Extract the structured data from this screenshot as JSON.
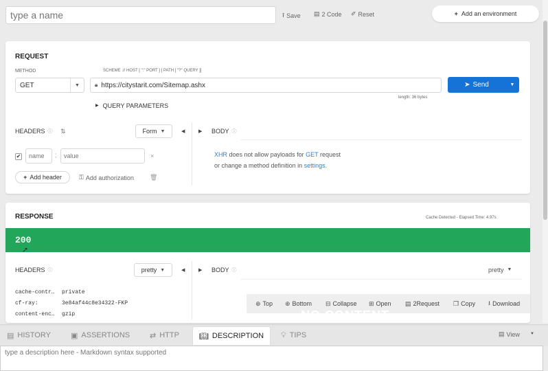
{
  "topbar": {
    "name_placeholder": "type a name",
    "save_label": "Save",
    "code_label": "2 Code",
    "reset_label": "Reset",
    "add_env_label": "Add an environment"
  },
  "request": {
    "title": "REQUEST",
    "method_label": "METHOD",
    "method_value": "GET",
    "scheme_label": "SCHEME :// HOST [ \":\" PORT ] [ PATH [ \"?\" QUERY ]]",
    "url_value": "https://citystarit.com/Sitemap.ashx",
    "length_text": "length: 36 bytes",
    "send_label": "Send",
    "query_params_label": "QUERY PARAMETERS",
    "headers_label": "HEADERS",
    "form_label": "Form",
    "body_label": "BODY",
    "header_name_placeholder": "name",
    "header_value_placeholder": "value",
    "add_header_label": "Add header",
    "add_authorization_label": "Add authorization",
    "body_message_part1": "does not allow payloads for",
    "body_message_xhr": "XHR",
    "body_message_get": "GET",
    "body_message_request": "request",
    "body_message_line2": "or change a method definition in",
    "body_message_settings": "settings."
  },
  "response": {
    "title": "RESPONSE",
    "meta_text": "Cache Detected - Elapsed Time: 4.97s",
    "status_code": "200",
    "headers_label": "HEADERS",
    "pretty_label": "pretty",
    "body_label": "BODY",
    "body_pretty_label": "pretty",
    "headers": [
      {
        "key": "cache-contr…",
        "value": "private"
      },
      {
        "key": "cf-ray:",
        "value": "3e84af44c8e34322-FKP"
      },
      {
        "key": "content-enc…",
        "value": "gzip"
      }
    ],
    "toolbar": {
      "top": "Top",
      "bottom": "Bottom",
      "collapse": "Collapse",
      "open": "Open",
      "to_request": "2Request",
      "copy": "Copy",
      "download": "Download"
    },
    "watermark": "NO CONTENT"
  },
  "bottom_tabs": {
    "history": "HISTORY",
    "assertions": "ASSERTIONS",
    "http": "HTTP",
    "description": "DESCRIPTION",
    "tips": "TIPS",
    "view": "View"
  },
  "description": {
    "placeholder": "type a description here - Markdown syntax supported"
  },
  "colors": {
    "success": "#21a65a",
    "send": "#1572d6",
    "link": "#2f7fd1"
  }
}
